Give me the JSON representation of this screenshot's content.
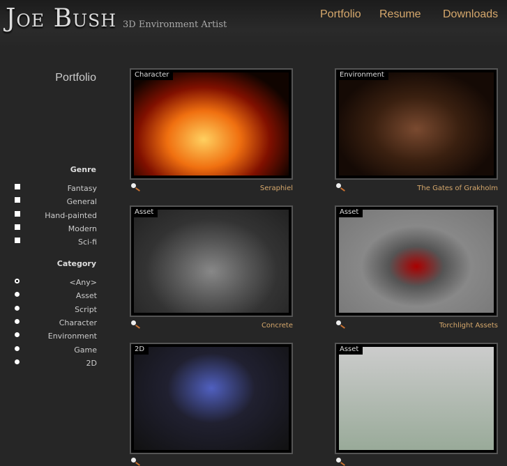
{
  "header": {
    "logo": "Joe Bush",
    "tagline": "3D Environment Artist",
    "nav": [
      "Portfolio",
      "Resume",
      "Downloads"
    ]
  },
  "sidebar": {
    "title": "Portfolio",
    "genre_heading": "Genre",
    "genres": [
      "Fantasy",
      "General",
      "Hand-painted",
      "Modern",
      "Sci-fi"
    ],
    "category_heading": "Category",
    "categories": [
      "<Any>",
      "Asset",
      "Script",
      "Character",
      "Environment",
      "Game",
      "2D"
    ],
    "selected_category": "<Any>"
  },
  "items": [
    {
      "tag": "Character",
      "title": "Seraphiel"
    },
    {
      "tag": "Environment",
      "title": "The Gates of Grakholm"
    },
    {
      "tag": "Asset",
      "title": "Concrete"
    },
    {
      "tag": "Asset",
      "title": "Torchlight Assets"
    },
    {
      "tag": "2D",
      "title": ""
    },
    {
      "tag": "Asset",
      "title": ""
    }
  ]
}
